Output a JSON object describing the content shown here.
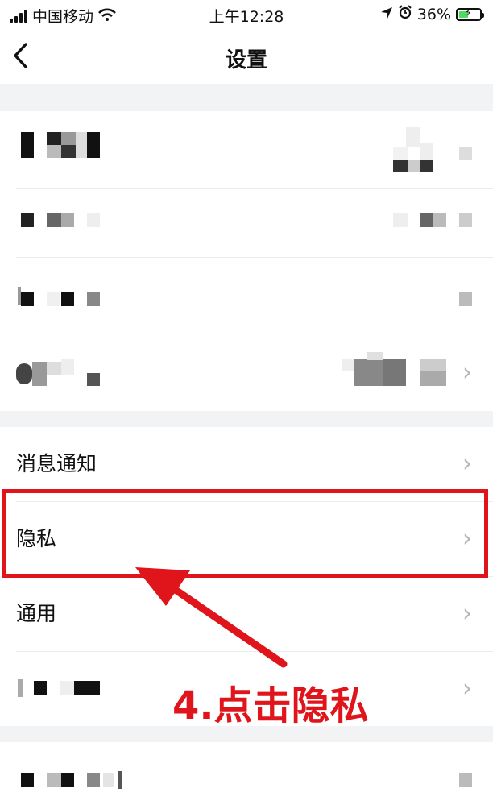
{
  "status_bar": {
    "carrier": "中国移动",
    "time": "上午12:28",
    "battery": "36%"
  },
  "header": {
    "title": "设置",
    "back_icon": "chevron-left-icon"
  },
  "settings_items": [
    {
      "label": "消息通知"
    },
    {
      "label": "隐私"
    },
    {
      "label": "通用"
    }
  ],
  "annotation": {
    "text": "4.点击隐私",
    "color": "#e0141b"
  }
}
